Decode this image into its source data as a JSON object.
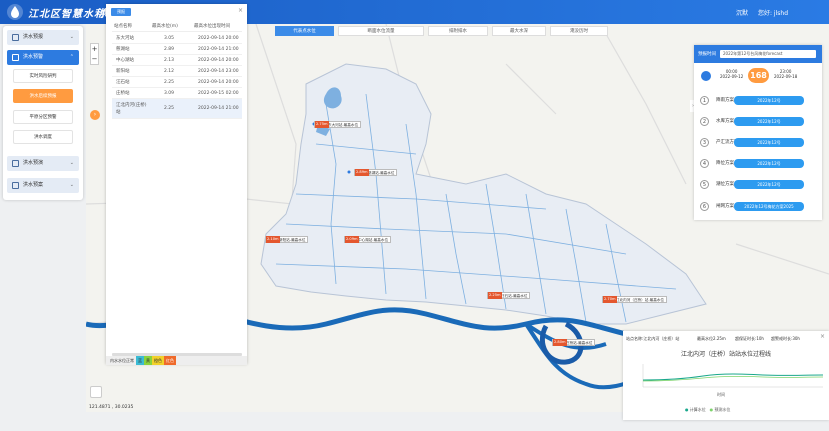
{
  "header": {
    "title": "江北区智慧水利",
    "title2": "洪",
    "link1": "沉默",
    "user": "您好: jlshd"
  },
  "tabs": [
    {
      "label": "代表点水位"
    },
    {
      "label": "断面水位流量"
    },
    {
      "label": "排附排水"
    },
    {
      "label": "最大水深"
    },
    {
      "label": "淹没历时"
    }
  ],
  "sidebar": {
    "menu1": "洪水预报",
    "menu2": "洪水预警",
    "sub": [
      "实时风险研判",
      "洪水后续预报",
      "平原分区预警",
      "洪水调度"
    ],
    "menu3": "洪水预演",
    "menu4": "洪水预案"
  },
  "station_table": {
    "tab": "预报",
    "headers": [
      "站点名称",
      "最高水位(m)",
      "最高水位出现时间"
    ],
    "rows": [
      [
        "东大河站",
        "3.05",
        "2022-09-14 20:00"
      ],
      [
        "慈湖站",
        "2.89",
        "2022-09-14 21:00"
      ],
      [
        "中心湖站",
        "2.13",
        "2022-09-14 20:00"
      ],
      [
        "新阳站",
        "2.12",
        "2022-09-14 23:00"
      ],
      [
        "汪石站",
        "2.25",
        "2022-09-14 20:00"
      ],
      [
        "庄桥站",
        "3.09",
        "2022-09-15 02:00"
      ],
      [
        "江北内河(庄桥)站",
        "2.25",
        "2022-09-14 21:00"
      ]
    ],
    "legend": [
      "内水水位正常",
      "蓝",
      "黄",
      "橙色",
      "红色"
    ]
  },
  "map_labels": [
    {
      "val": "2.75m",
      "name": "东大河站-最高水位"
    },
    {
      "val": "2.89m",
      "name": "慈湖站-最高水位"
    },
    {
      "val": "2.10m",
      "name": "新阳站-最高水位"
    },
    {
      "val": "2.09m",
      "name": "中心湖站-最高水位"
    },
    {
      "val": "2.25m",
      "name": "汪石站-最高水位"
    },
    {
      "val": "2.70m",
      "name": "江北内河（庄桥）站-最高水位"
    },
    {
      "val": "2.80m",
      "name": "庄桥站-最高水位"
    }
  ],
  "forecast": {
    "label": "预报时间",
    "time_value": "2022年第12号台风梅花forecast",
    "start_time": "00:00",
    "start_date": "2022-09-12",
    "end_time": "23:00",
    "end_date": "2022-09-18",
    "hours": "168",
    "plans": [
      {
        "num": "1",
        "name": "降雨方案",
        "value": "2022年12号"
      },
      {
        "num": "2",
        "name": "水库方案",
        "value": "2022年12号"
      },
      {
        "num": "3",
        "name": "产汇流方案",
        "value": "2022年12号"
      },
      {
        "num": "4",
        "name": "降位方案",
        "value": "2022年12号"
      },
      {
        "num": "5",
        "name": "潮位方案",
        "value": "2022年12号"
      },
      {
        "num": "6",
        "name": "闸网方案",
        "value": "2022年12号梅花方案2025"
      }
    ]
  },
  "gauge_panel": {
    "station": "站点名称:江北内河（庄桥）站",
    "max_level": "最高水位2.25m",
    "warn": "超保证时长:10h",
    "alarm": "超警戒时长:30h",
    "title": "江北内河（庄桥）站站水位过程线",
    "legend1": "计算水位",
    "legend2": "预测水位",
    "xlabel": "时间"
  },
  "coords": "121.4871 , 30.0235"
}
